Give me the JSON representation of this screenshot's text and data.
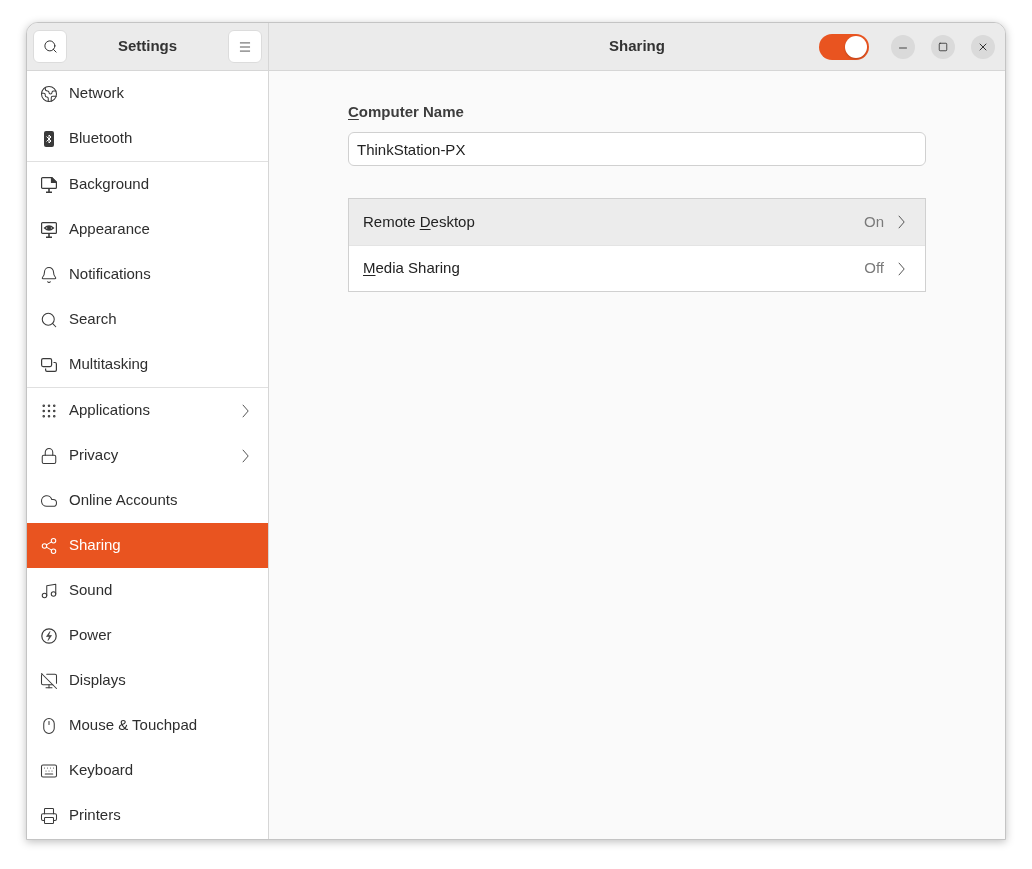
{
  "sidebar": {
    "title": "Settings",
    "groups": [
      {
        "items": [
          {
            "label": "Network",
            "selected": false,
            "submenu": false
          },
          {
            "label": "Bluetooth",
            "selected": false,
            "submenu": false
          }
        ]
      },
      {
        "items": [
          {
            "label": "Background",
            "selected": false,
            "submenu": false
          },
          {
            "label": "Appearance",
            "selected": false,
            "submenu": false
          },
          {
            "label": "Notifications",
            "selected": false,
            "submenu": false
          },
          {
            "label": "Search",
            "selected": false,
            "submenu": false
          },
          {
            "label": "Multitasking",
            "selected": false,
            "submenu": false
          }
        ]
      },
      {
        "items": [
          {
            "label": "Applications",
            "selected": false,
            "submenu": true
          },
          {
            "label": "Privacy",
            "selected": false,
            "submenu": true
          },
          {
            "label": "Online Accounts",
            "selected": false,
            "submenu": false
          },
          {
            "label": "Sharing",
            "selected": true,
            "submenu": false
          },
          {
            "label": "Sound",
            "selected": false,
            "submenu": false
          },
          {
            "label": "Power",
            "selected": false,
            "submenu": false
          },
          {
            "label": "Displays",
            "selected": false,
            "submenu": false
          },
          {
            "label": "Mouse & Touchpad",
            "selected": false,
            "submenu": false
          },
          {
            "label": "Keyboard",
            "selected": false,
            "submenu": false
          },
          {
            "label": "Printers",
            "selected": false,
            "submenu": false
          }
        ]
      }
    ]
  },
  "header": {
    "title": "Sharing",
    "toggle": {
      "on": true
    }
  },
  "sharing": {
    "computer_name": {
      "label_words": [
        {
          "text": "Computer",
          "mnemonic": true
        },
        {
          "text": "Name",
          "mnemonic": false
        }
      ],
      "value": "ThinkStation-PX"
    },
    "services": [
      {
        "label_words": [
          {
            "text": "Remote",
            "mnemonic": false
          },
          {
            "text": "Desktop",
            "mnemonic": true
          }
        ],
        "status": "On",
        "highlighted": true
      },
      {
        "label_words": [
          {
            "text": "Media",
            "mnemonic": true
          },
          {
            "text": "Sharing",
            "mnemonic": false
          }
        ],
        "status": "Off",
        "highlighted": false
      }
    ]
  }
}
